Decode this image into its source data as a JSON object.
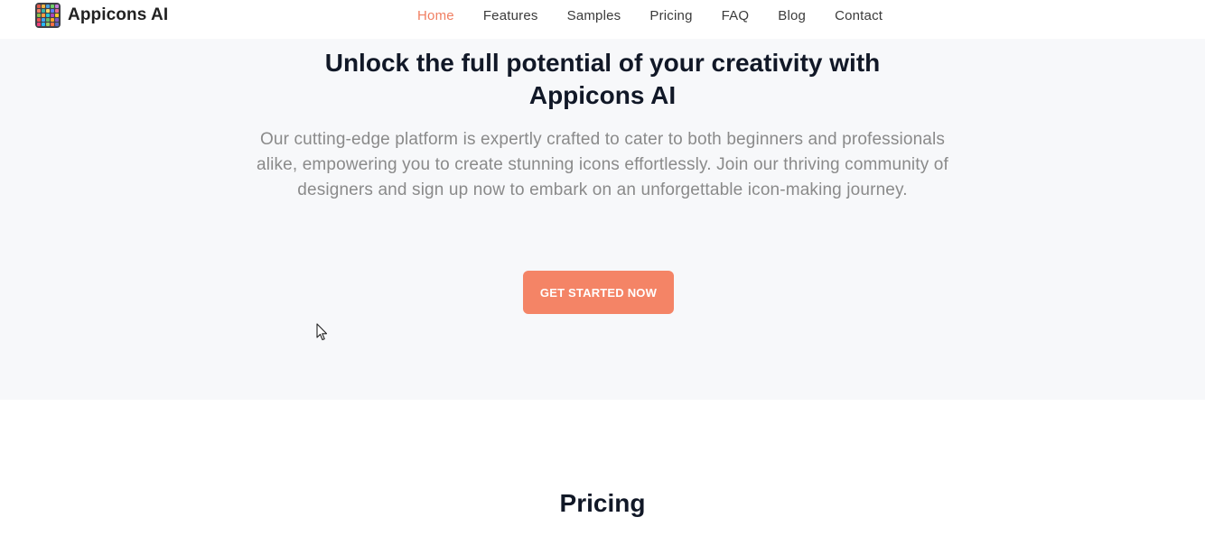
{
  "brand": {
    "name": "Appicons AI",
    "logo_icon": "app-grid-logo-icon",
    "logo_colors": [
      "#e0584a",
      "#f2b544",
      "#4aa3df",
      "#6fcf6a",
      "#c77dd8",
      "#f07f62",
      "#3bb3a8",
      "#f5d76e",
      "#5c7cfa",
      "#e86a92",
      "#8bc34a",
      "#ff9f43",
      "#26c6da",
      "#ab47bc",
      "#ffca28",
      "#ef5350",
      "#42a5f5",
      "#66bb6a",
      "#ffa726",
      "#7e57c2",
      "#ec407a",
      "#29b6f6",
      "#9ccc65",
      "#ff7043",
      "#5c6bc0"
    ]
  },
  "nav": {
    "items": [
      {
        "label": "Home",
        "active": true
      },
      {
        "label": "Features",
        "active": false
      },
      {
        "label": "Samples",
        "active": false
      },
      {
        "label": "Pricing",
        "active": false
      },
      {
        "label": "FAQ",
        "active": false
      },
      {
        "label": "Blog",
        "active": false
      },
      {
        "label": "Contact",
        "active": false
      }
    ]
  },
  "hero": {
    "title_line1": "Unlock the full potential of your creativity with",
    "title_line2": "Appicons AI",
    "description": "Our cutting-edge platform is expertly crafted to cater to both beginners and professionals alike, empowering you to create stunning icons effortlessly. Join our thriving community of designers and sign up now to embark on an unforgettable icon-making journey.",
    "cta_label": "GET STARTED NOW"
  },
  "pricing": {
    "title": "Pricing"
  },
  "colors": {
    "accent": "#f07f62",
    "button": "#f48466",
    "hero_bg": "#f7f8fa",
    "heading": "#111827",
    "body_text": "#8a8a8a"
  }
}
